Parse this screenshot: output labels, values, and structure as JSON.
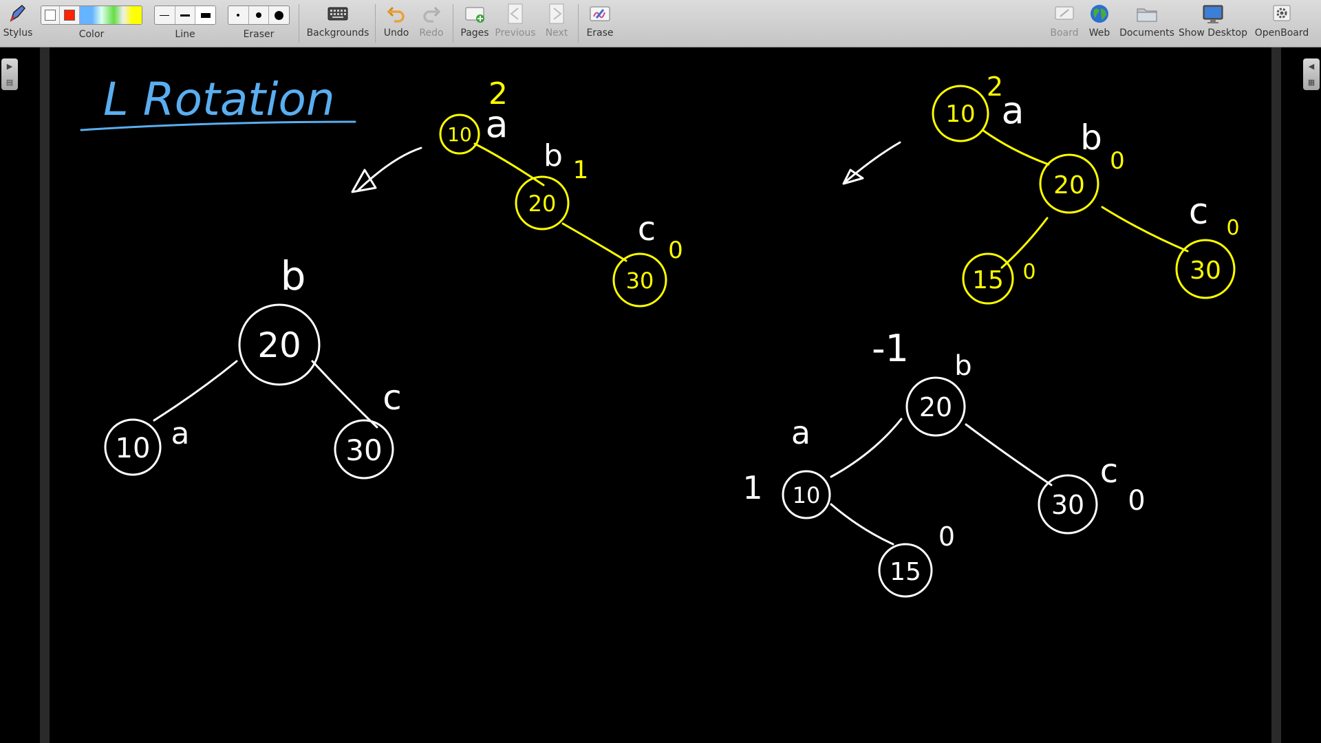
{
  "toolbar": {
    "stylus_label": "Stylus",
    "color_label": "Color",
    "colors": [
      "#ffffff",
      "#ff2200",
      "#66b3ff",
      "#66dd44",
      "#ffff00"
    ],
    "line_label": "Line",
    "eraser_label": "Eraser",
    "backgrounds_label": "Backgrounds",
    "undo_label": "Undo",
    "redo_label": "Redo",
    "pages_label": "Pages",
    "previous_label": "Previous",
    "next_label": "Next",
    "erase_label": "Erase",
    "board_label": "Board",
    "web_label": "Web",
    "documents_label": "Documents",
    "show_desktop_label": "Show Desktop",
    "openboard_label": "OpenBoard"
  },
  "board": {
    "title": "L Rotation",
    "ink_colors": {
      "title": "#5aaef0",
      "yellow": "#ffff00",
      "white": "#ffffff"
    },
    "tree_top_left": {
      "a": "10",
      "b": "20",
      "c": "30",
      "a_label": "a",
      "b_label": "b",
      "c_label": "c",
      "a_bf": "2",
      "b_bf": "1",
      "c_bf": "0"
    },
    "tree_bottom_left": {
      "root": "20",
      "left": "10",
      "right": "30",
      "root_label": "b",
      "left_label": "a",
      "right_label": "c"
    },
    "tree_top_right": {
      "root": "10",
      "mid": "20",
      "left": "15",
      "right": "30",
      "root_label": "a",
      "mid_label": "b",
      "right_label": "c",
      "root_bf": "2",
      "mid_bf": "0",
      "left_bf": "0",
      "right_bf": "0"
    },
    "tree_bottom_right": {
      "root": "20",
      "left": "10",
      "leaf": "15",
      "right": "30",
      "root_label": "b",
      "left_label": "a",
      "right_label": "c",
      "root_bf": "-1",
      "left_bf": "1",
      "leaf_bf": "0",
      "right_bf": "0"
    }
  }
}
